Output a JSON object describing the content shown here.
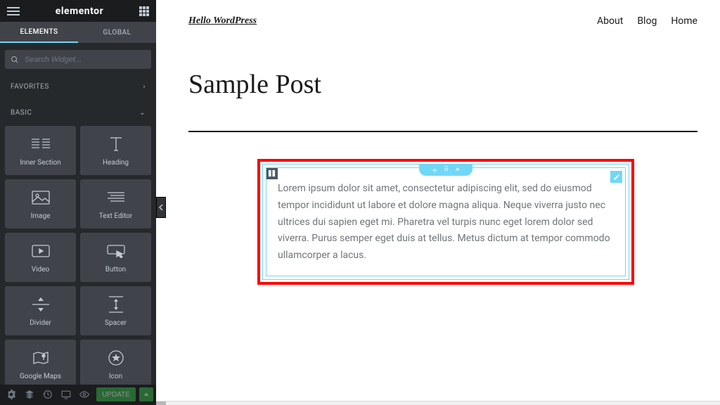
{
  "app": {
    "name": "elementor"
  },
  "tabs": {
    "elements": "ELEMENTS",
    "global": "GLOBAL"
  },
  "search": {
    "placeholder": "Search Widget..."
  },
  "categories": {
    "favorites": "FAVORITES",
    "basic": "BASIC"
  },
  "widgets": [
    {
      "label": "Inner Section"
    },
    {
      "label": "Heading"
    },
    {
      "label": "Image"
    },
    {
      "label": "Text Editor"
    },
    {
      "label": "Video"
    },
    {
      "label": "Button"
    },
    {
      "label": "Divider"
    },
    {
      "label": "Spacer"
    },
    {
      "label": "Google Maps"
    },
    {
      "label": "Icon"
    }
  ],
  "footer": {
    "update": "UPDATE"
  },
  "site": {
    "title": "Hello WordPress",
    "nav": [
      "About",
      "Blog",
      "Home"
    ]
  },
  "post": {
    "title": "Sample Post",
    "body": "Lorem ipsum dolor sit amet, consectetur adipiscing elit, sed do eiusmod tempor incididunt ut labore et dolore magna aliqua. Neque viverra justo nec ultrices dui sapien eget mi. Pharetra vel turpis nunc eget lorem dolor sed viverra. Purus semper eget duis at tellus. Metus dictum at tempor commodo ullamcorper a lacus."
  }
}
